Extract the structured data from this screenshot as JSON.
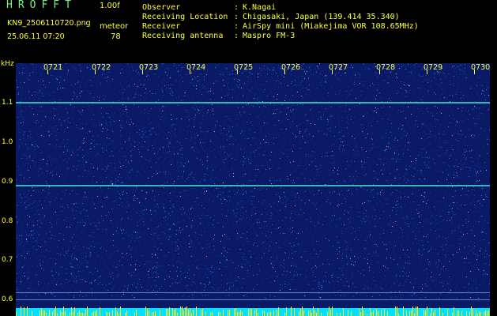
{
  "header": {
    "app_title": "HROFFT",
    "version": "1.00f",
    "filename": "KN9_2506110720.png",
    "mode": "meteor",
    "datetime": "25.06.11 07:20",
    "count": "78"
  },
  "metadata": [
    {
      "label": "Observer",
      "value": "K.Nagai"
    },
    {
      "label": "Receiving Location",
      "value": "Chigasaki, Japan (139.414 35.340)"
    },
    {
      "label": "Receiver",
      "value": "AirSpy mini (Miakejima VOR 108.65MHz)"
    },
    {
      "label": "Receiving antenna",
      "value": "Maspro FM-3"
    }
  ],
  "separator": ":",
  "spectrogram": {
    "y_unit": "kHz",
    "y_ticks": [
      "1.1",
      "1.0",
      "0.9",
      "0.8",
      "0.7",
      "0.6"
    ],
    "time_labels": [
      "0721",
      "0722",
      "0723",
      "0724",
      "0725",
      "0726",
      "0727",
      "0728",
      "0729",
      "0730"
    ],
    "colors": {
      "background": "#0a1a64",
      "noise": "#3a6cff",
      "carrier_line": "#39d6c8",
      "baseline": "#00e0ff",
      "spikes": "#ffff00",
      "text": "#ffff3a",
      "title": "#7ff07f"
    }
  }
}
